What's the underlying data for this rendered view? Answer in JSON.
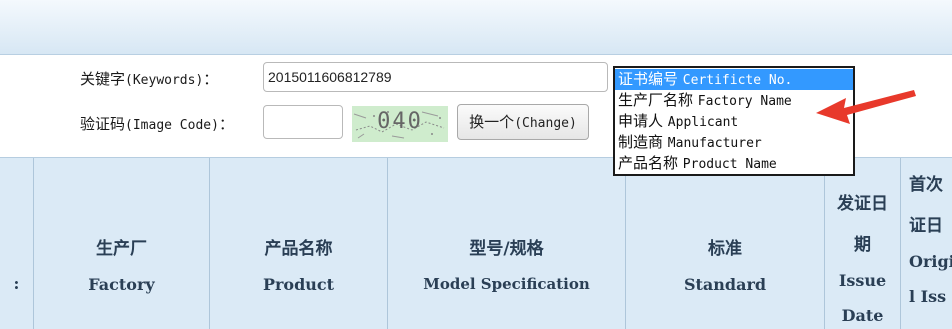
{
  "form": {
    "keywords_label_zh": "关键字",
    "keywords_label_en": "(Keywords)",
    "keywords_label_colon": "：",
    "keywords_value": "2015011606812789",
    "image_code_label_zh": "验证码",
    "image_code_label_en": "(Image Code)",
    "image_code_label_colon": "：",
    "image_code_value": "",
    "captcha_text": "040",
    "change_button_zh": "换一个",
    "change_button_en": "(Change)"
  },
  "dropdown": {
    "selected_index": 0,
    "options": [
      {
        "zh": "证书编号",
        "en": "Certificte No."
      },
      {
        "zh": "生产厂名称",
        "en": "Factory Name"
      },
      {
        "zh": "申请人",
        "en": "Applicant"
      },
      {
        "zh": "制造商",
        "en": "Manufacturer"
      },
      {
        "zh": "产品名称",
        "en": "Product Name"
      }
    ]
  },
  "table": {
    "columns": [
      {
        "zh": "生产厂",
        "en": "Factory"
      },
      {
        "zh": "产品名称",
        "en": "Product"
      },
      {
        "zh": "型号/规格",
        "en": "Model Specification"
      },
      {
        "zh": "标准",
        "en": "Standard"
      }
    ],
    "issue_date": {
      "line1": "发证日",
      "line2": "期",
      "line3": "Issue",
      "line4": "Date"
    },
    "original": {
      "line1": "首次",
      "line2": "证日",
      "line3": "Origi",
      "line4": "l Iss"
    }
  },
  "colors": {
    "header_bg": "#dbeaf6",
    "selected_option": "#3399ff",
    "arrow": "#e8392b",
    "captcha_bg": "#cfeccd"
  }
}
